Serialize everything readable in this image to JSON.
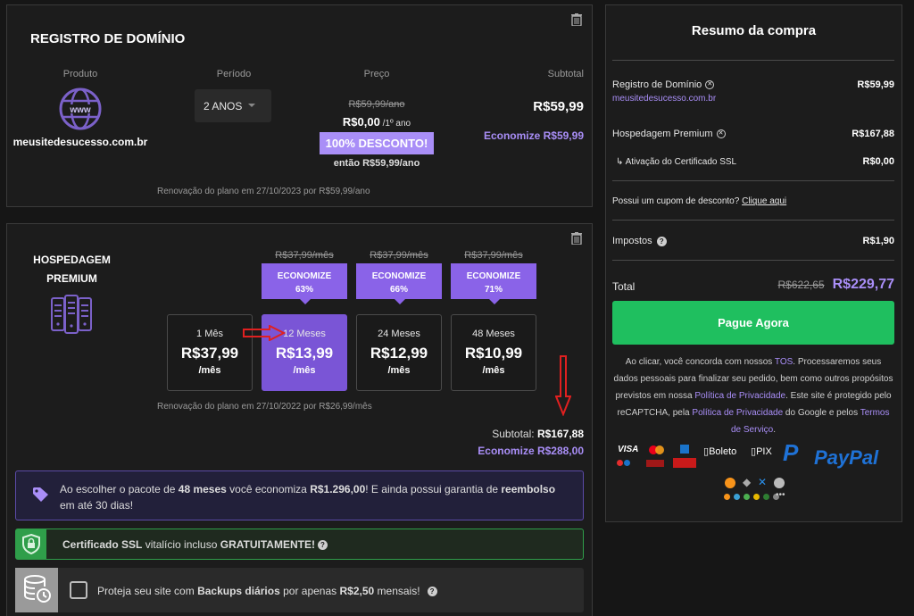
{
  "domain": {
    "title": "REGISTRO DE DOMÍNIO",
    "col_product": "Produto",
    "col_period": "Período",
    "col_price": "Preço",
    "col_subtotal": "Subtotal",
    "name": "meusitedesucesso.com.br",
    "period": "2 ANOS",
    "old_price": "R$59,99/ano",
    "price": "R$0,00",
    "price_suffix": " /1º ano",
    "discount": "100% DESCONTO!",
    "then": "então R$59,99/ano",
    "subtotal": "R$59,99",
    "economize": "Economize R$59,99",
    "renewal": "Renovação do plano em 27/10/2023 por R$59,99/ano",
    "www": "www"
  },
  "hosting": {
    "title_line1": "HOSPEDAGEM",
    "title_line2": "PREMIUM",
    "plans": [
      {
        "label": "1 Mês",
        "price": "R$37,99",
        "per": "/mês",
        "old": "",
        "save_l1": "",
        "save_l2": ""
      },
      {
        "label": "12 Meses",
        "price": "R$13,99",
        "per": "/mês",
        "old": "R$37,99/mês",
        "save_l1": "ECONOMIZE",
        "save_l2": "63%"
      },
      {
        "label": "24 Meses",
        "price": "R$12,99",
        "per": "/mês",
        "old": "R$37,99/mês",
        "save_l1": "ECONOMIZE",
        "save_l2": "66%"
      },
      {
        "label": "48 Meses",
        "price": "R$10,99",
        "per": "/mês",
        "old": "R$37,99/mês",
        "save_l1": "ECONOMIZE",
        "save_l2": "71%"
      }
    ],
    "renewal": "Renovação do plano em 27/10/2022 por R$26,99/mês",
    "subtotal_label": "Subtotal:",
    "subtotal": "R$167,88",
    "economize": "Economize R$288,00"
  },
  "promo": {
    "a": "Ao escolher o pacote de ",
    "b": "48 meses",
    "c": " você economiza ",
    "d": "R$1.296,00",
    "e": "! E ainda possui garantia de ",
    "f": "reembolso",
    "g": "em até 30 dias!"
  },
  "ssl": {
    "a": "Certificado SSL",
    "b": " vitalício incluso ",
    "c": "GRATUITAMENTE!"
  },
  "backup": {
    "a": "Proteja seu site com ",
    "b": "Backups diários",
    "c": " por apenas ",
    "d": "R$2,50",
    "e": " mensais!"
  },
  "summary": {
    "title": "Resumo da compra",
    "item1": "Registro de Domínio",
    "item1_sub": "meusitedesucesso.com.br",
    "item1_price": "R$59,99",
    "item2": "Hospedagem Premium",
    "item2_price": "R$167,88",
    "item3": "↳ Ativação do Certificado SSL",
    "item3_price": "R$0,00",
    "coupon": "Possui um cupom de desconto?",
    "coupon_link": "Clique aqui",
    "taxes": "Impostos",
    "taxes_price": "R$1,90",
    "total": "Total",
    "total_old": "R$622,65",
    "total_new": "R$229,77",
    "pay_button": "Pague Agora",
    "legal_1": "Ao clicar, você concorda com nossos ",
    "legal_tos": "TOS",
    "legal_2": ". Processaremos seus dados pessoais para finalizar seu pedido, bem como outros propósitos previstos em nossa ",
    "legal_priv": "Política de Privacidade",
    "legal_3": ". Este site é protegido pelo reCAPTCHA, pela ",
    "legal_priv2": "Política de Privacidade",
    "legal_4": " do Google e pelos ",
    "legal_terms": "Termos de Serviço",
    "legal_5": ".",
    "pay_visa": "VISA",
    "pay_boleto": "Boleto",
    "pay_pix": "PIX",
    "pay_paypal": "PayPal"
  },
  "colors": {
    "accent": "#8a63e8",
    "green": "#1fbf5f",
    "bg": "#161616"
  }
}
